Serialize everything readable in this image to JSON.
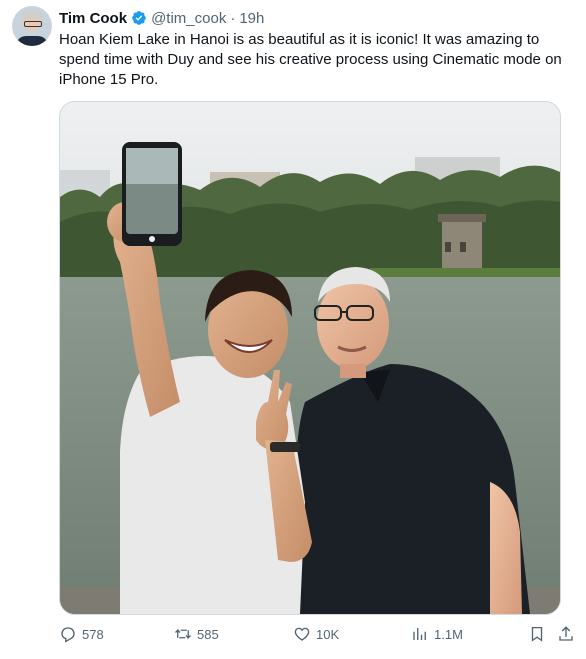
{
  "author": {
    "name": "Tim Cook",
    "handle": "@tim_cook",
    "separator": "·",
    "time": "19h",
    "avatar_icon": "avatar",
    "verified_icon": "verified-badge-icon"
  },
  "tweet": {
    "text": "Hoan Kiem Lake in Hanoi is as beautiful as it is iconic! It was amazing to spend time with Duy and see his creative process using Cinematic mode on iPhone 15 Pro."
  },
  "more_label": "···",
  "actions": {
    "replies": "578",
    "retweets": "585",
    "likes": "10K",
    "views": "1.1M"
  },
  "colors": {
    "text": "#0f1419",
    "secondary": "#536471",
    "verified": "#1d9bf0",
    "border": "#cfd9de"
  }
}
